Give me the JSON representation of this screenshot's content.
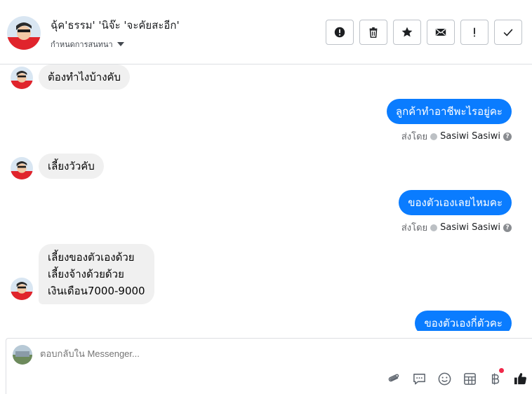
{
  "header": {
    "contact_name": "ฉุ้ค'ธรรม' 'นิจ๊ะ 'จะคัยสะอีก'",
    "subtitle": "กำหนดการสนทนา",
    "toolbar_icons": [
      "exclamation-circle-icon",
      "trash-icon",
      "star-icon",
      "envelope-icon",
      "exclamation-icon",
      "check-icon"
    ]
  },
  "messages": [
    {
      "direction": "in",
      "lines": [
        "ต้องทำไงบ้างคับ"
      ]
    },
    {
      "direction": "out",
      "lines": [
        "ลูกค้าทำอาชีพะไรอยู่คะ"
      ],
      "sent_by_label": "ส่งโดย",
      "sent_by_name": "Sasiwi Sasiwi"
    },
    {
      "direction": "in",
      "lines": [
        "เลี้ยงวัวคับ"
      ]
    },
    {
      "direction": "out",
      "lines": [
        "ของตัวเองเลยไหมคะ"
      ],
      "sent_by_label": "ส่งโดย",
      "sent_by_name": "Sasiwi Sasiwi"
    },
    {
      "direction": "in",
      "lines": [
        "เลี้ยงของตัวเองด้วย",
        "เลี้ยงจ้างด้วยด้วย",
        "เงินเดือน7000-9000"
      ]
    },
    {
      "direction": "out",
      "lines": [
        "ของตัวเองกี่ตัวคะ"
      ]
    }
  ],
  "composer": {
    "placeholder": "ตอบกลับใน Messenger...",
    "icons": [
      "paperclip-icon",
      "speech-bubble-icon",
      "smiley-icon",
      "table-icon",
      "baht-icon",
      "thumbs-up-icon"
    ]
  },
  "colors": {
    "outgoing": "#0a7cff",
    "incoming": "#f0f0f0",
    "notification_dot": "#f02849"
  }
}
